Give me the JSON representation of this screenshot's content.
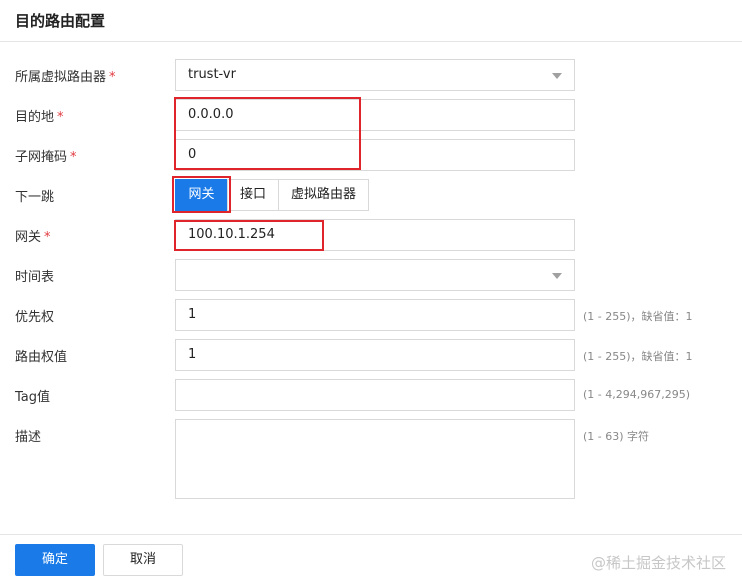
{
  "header": {
    "title": "目的路由配置"
  },
  "form": {
    "vrouter": {
      "label": "所属虚拟路由器",
      "required": "*",
      "value": "trust-vr"
    },
    "destination": {
      "label": "目的地",
      "required": "*",
      "value": "0.0.0.0"
    },
    "mask": {
      "label": "子网掩码",
      "required": "*",
      "value": "0"
    },
    "next_hop": {
      "label": "下一跳",
      "options": [
        "网关",
        "接口",
        "虚拟路由器"
      ],
      "selected": "网关"
    },
    "gateway": {
      "label": "网关",
      "required": "*",
      "value": "100.10.1.254"
    },
    "schedule": {
      "label": "时间表",
      "value": ""
    },
    "priority": {
      "label": "优先权",
      "value": "1",
      "hint": "(1 - 255)，缺省值：1"
    },
    "weight": {
      "label": "路由权值",
      "value": "1",
      "hint": "(1 - 255)，缺省值：1"
    },
    "tag": {
      "label": "Tag值",
      "value": "",
      "hint": "(1 - 4,294,967,295)"
    },
    "description": {
      "label": "描述",
      "value": "",
      "hint": "(1 - 63) 字符"
    }
  },
  "footer": {
    "confirm_label": "确定",
    "cancel_label": "取消"
  },
  "watermark": "@稀土掘金技术社区",
  "colors": {
    "accent": "#1a7be8",
    "highlight": "#e0242b",
    "required": "#e0393e"
  }
}
